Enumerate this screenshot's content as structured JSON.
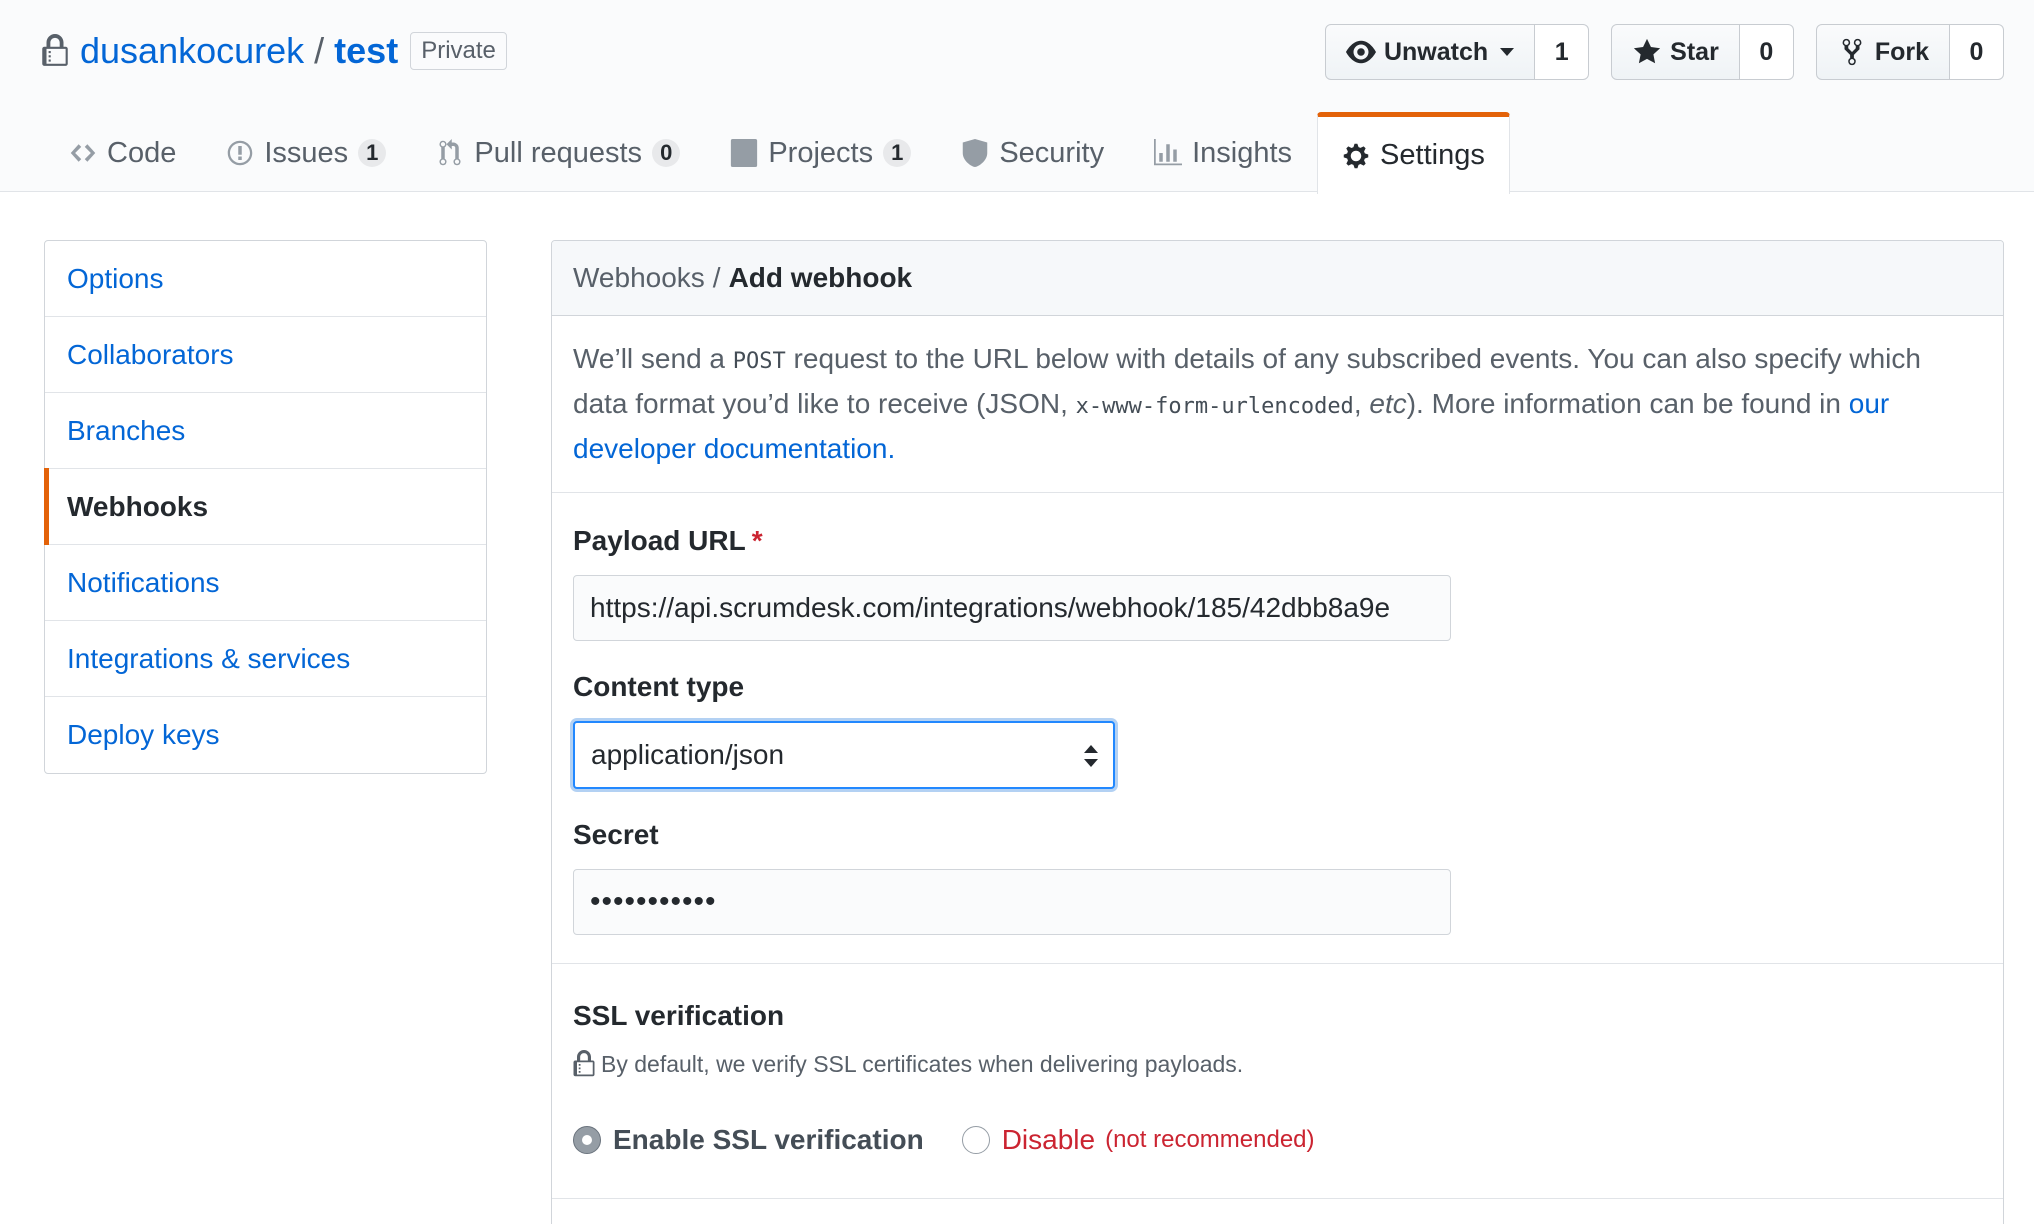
{
  "repo": {
    "owner": "dusankocurek",
    "separator": "/",
    "name": "test",
    "visibility": "Private"
  },
  "actions": {
    "watch": {
      "label": "Unwatch",
      "count": "1"
    },
    "star": {
      "label": "Star",
      "count": "0"
    },
    "fork": {
      "label": "Fork",
      "count": "0"
    }
  },
  "tabs": [
    {
      "label": "Code",
      "icon": "code-icon"
    },
    {
      "label": "Issues",
      "icon": "issue-icon",
      "count": "1"
    },
    {
      "label": "Pull requests",
      "icon": "pull-request-icon",
      "count": "0"
    },
    {
      "label": "Projects",
      "icon": "project-icon",
      "count": "1"
    },
    {
      "label": "Security",
      "icon": "shield-icon"
    },
    {
      "label": "Insights",
      "icon": "graph-icon"
    },
    {
      "label": "Settings",
      "icon": "gear-icon",
      "selected": true
    }
  ],
  "sidebar": {
    "items": [
      {
        "label": "Options"
      },
      {
        "label": "Collaborators"
      },
      {
        "label": "Branches"
      },
      {
        "label": "Webhooks",
        "selected": true
      },
      {
        "label": "Notifications"
      },
      {
        "label": "Integrations & services"
      },
      {
        "label": "Deploy keys"
      }
    ]
  },
  "main": {
    "breadcrumb": {
      "parent": "Webhooks",
      "separator": "/",
      "current": "Add webhook"
    },
    "intro": {
      "part1": "We’ll send a ",
      "code1": "POST",
      "part2": " request to the URL below with details of any subscribed events. You can also specify which data format you’d like to receive (JSON, ",
      "code2": "x-www-form-urlencoded",
      "part3": ", ",
      "em": "etc",
      "part4": "). More information can be found in ",
      "link": "our developer documentation",
      "part5": "."
    },
    "payload_url": {
      "label": "Payload URL",
      "required_mark": "*",
      "value": "https://api.scrumdesk.com/integrations/webhook/185/42dbb8a9e"
    },
    "content_type": {
      "label": "Content type",
      "value": "application/json"
    },
    "secret": {
      "label": "Secret",
      "value": "•••••••••••"
    },
    "ssl": {
      "title": "SSL verification",
      "note": "By default, we verify SSL certificates when delivering payloads.",
      "enable_label": "Enable SSL verification",
      "disable_label": "Disable",
      "disable_note": "(not recommended)"
    }
  },
  "colors": {
    "link": "#0366d6",
    "accent": "#e36209",
    "danger": "#cb2431",
    "focus": "#2188ff"
  }
}
